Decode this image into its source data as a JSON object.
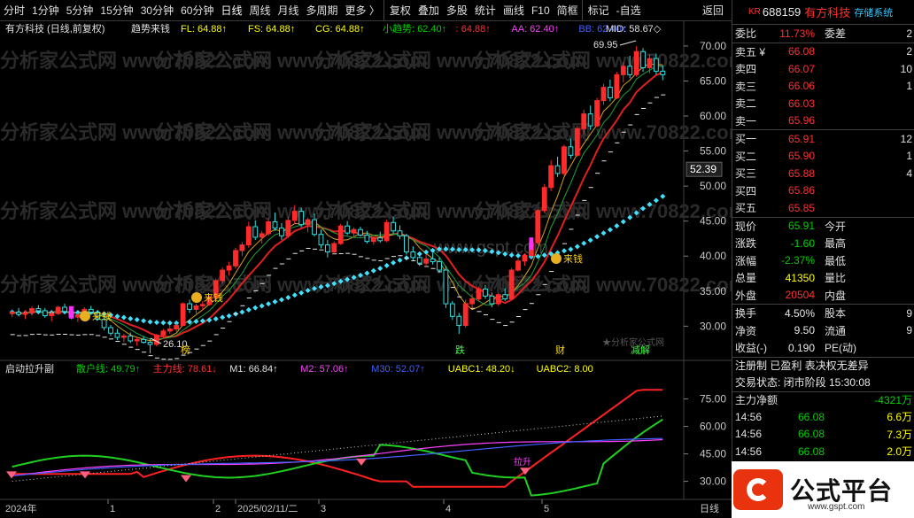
{
  "toolbar": {
    "items": [
      "分时",
      "1分钟",
      "5分钟",
      "15分钟",
      "30分钟",
      "60分钟",
      "日线",
      "周线",
      "月线",
      "多周期",
      "更多 〉",
      "复权",
      "叠加",
      "多股",
      "统计",
      "画线",
      "F10",
      "简框",
      "标记",
      "-自选",
      "返回"
    ]
  },
  "chart": {
    "title": "有方科技 (日线,前复权)",
    "indicator_name": "趋势来钱",
    "legend": [
      {
        "text": "FL: 64.88↑",
        "color": "#ffff00"
      },
      {
        "text": "FS: 64.88↑",
        "color": "#ffff00"
      },
      {
        "text": "CG: 64.88↑",
        "color": "#ffff00"
      },
      {
        "text": "小趋势: 62.40↑",
        "color": "#00d000"
      },
      {
        "text": ": 64.88↑",
        "color": "#ff3030"
      },
      {
        "text": "AA: 62.40↑",
        "color": "#ff40ff"
      },
      {
        "text": "BB: 62.40↑",
        "color": "#4060ff"
      },
      {
        "text": "MID: 58.67◇",
        "color": "#e0e0e0"
      }
    ],
    "yaxis": [
      "70.00",
      "65.00",
      "60.00",
      "55.00",
      "50.00",
      "45.00",
      "40.00",
      "35.00",
      "30.00"
    ],
    "price_marker": "52.39",
    "high_label": "69.95",
    "low_label": "26.10",
    "signals": [
      "来钱",
      "来钱",
      "来钱"
    ],
    "events": [
      "榜",
      "跌",
      "财",
      "减解"
    ],
    "watermark": "分析家公式网 www.70822.com",
    "watermark2": "www.gspt.com",
    "watermark3": "★分析家公式网",
    "chart_data": {
      "type": "candlestick",
      "ohlc": [
        [
          31.8,
          32.4,
          31.3,
          32.0
        ],
        [
          32.0,
          32.6,
          31.4,
          31.7
        ],
        [
          31.7,
          32.3,
          31.0,
          31.9
        ],
        [
          31.9,
          32.8,
          31.5,
          32.5
        ],
        [
          32.5,
          33.0,
          31.9,
          32.2
        ],
        [
          32.2,
          32.6,
          31.2,
          31.5
        ],
        [
          31.5,
          32.1,
          30.7,
          31.8
        ],
        [
          31.8,
          32.9,
          31.6,
          32.7
        ],
        [
          32.7,
          33.2,
          31.9,
          32.1
        ],
        [
          32.1,
          32.5,
          31.0,
          31.3
        ],
        [
          31.3,
          31.9,
          30.6,
          31.6
        ],
        [
          31.6,
          32.7,
          31.4,
          32.4
        ],
        [
          32.4,
          32.9,
          31.8,
          32.0
        ],
        [
          32.0,
          32.3,
          30.8,
          31.0
        ],
        [
          31.0,
          31.2,
          29.4,
          29.8
        ],
        [
          29.8,
          30.2,
          28.6,
          29.0
        ],
        [
          29.0,
          29.6,
          28.0,
          28.4
        ],
        [
          28.4,
          28.9,
          27.7,
          28.6
        ],
        [
          28.6,
          29.1,
          27.6,
          27.9
        ],
        [
          27.9,
          28.4,
          27.2,
          28.1
        ],
        [
          28.1,
          28.6,
          27.5,
          27.7
        ],
        [
          27.7,
          28.2,
          26.1,
          27.4
        ],
        [
          27.4,
          28.9,
          27.1,
          28.7
        ],
        [
          28.7,
          29.6,
          28.2,
          29.3
        ],
        [
          29.3,
          30.1,
          28.9,
          29.6
        ],
        [
          29.6,
          30.4,
          29.2,
          30.1
        ],
        [
          30.1,
          33.4,
          30.0,
          33.2
        ],
        [
          33.2,
          33.8,
          31.9,
          32.4
        ],
        [
          32.4,
          33.2,
          31.8,
          32.9
        ],
        [
          32.9,
          33.6,
          32.3,
          33.1
        ],
        [
          33.1,
          34.4,
          32.9,
          34.1
        ],
        [
          34.1,
          36.8,
          33.8,
          36.5
        ],
        [
          36.5,
          38.4,
          36.1,
          38.0
        ],
        [
          38.0,
          39.2,
          37.2,
          38.6
        ],
        [
          38.6,
          41.2,
          38.2,
          40.8
        ],
        [
          40.8,
          42.0,
          40.0,
          41.6
        ],
        [
          41.6,
          44.9,
          41.2,
          44.2
        ],
        [
          44.2,
          45.1,
          42.3,
          42.7
        ],
        [
          42.7,
          43.6,
          41.8,
          43.2
        ],
        [
          43.2,
          45.4,
          42.9,
          44.9
        ],
        [
          44.9,
          46.2,
          43.6,
          44.0
        ],
        [
          44.0,
          44.7,
          42.3,
          42.9
        ],
        [
          42.9,
          45.6,
          42.6,
          45.1
        ],
        [
          45.1,
          47.3,
          44.6,
          46.4
        ],
        [
          46.4,
          46.9,
          44.1,
          44.5
        ],
        [
          44.5,
          45.5,
          43.4,
          45.2
        ],
        [
          45.2,
          46.1,
          42.8,
          43.1
        ],
        [
          43.1,
          43.8,
          41.1,
          41.6
        ],
        [
          41.6,
          42.3,
          39.8,
          40.6
        ],
        [
          40.6,
          42.1,
          40.3,
          41.8
        ],
        [
          41.8,
          44.6,
          41.6,
          44.3
        ],
        [
          44.3,
          45.0,
          43.0,
          43.3
        ],
        [
          43.3,
          44.1,
          42.6,
          43.8
        ],
        [
          43.8,
          44.2,
          42.8,
          43.0
        ],
        [
          43.0,
          43.6,
          41.8,
          42.1
        ],
        [
          42.1,
          42.8,
          41.6,
          42.6
        ],
        [
          42.6,
          43.5,
          41.9,
          42.2
        ],
        [
          42.2,
          45.2,
          42.0,
          44.8
        ],
        [
          44.8,
          45.6,
          43.2,
          43.6
        ],
        [
          43.6,
          44.4,
          42.4,
          42.9
        ],
        [
          42.9,
          43.2,
          40.2,
          40.6
        ],
        [
          40.6,
          41.4,
          39.4,
          39.8
        ],
        [
          39.8,
          40.6,
          38.6,
          39.0
        ],
        [
          39.0,
          40.2,
          38.4,
          39.6
        ],
        [
          39.6,
          40.4,
          38.8,
          39.2
        ],
        [
          39.2,
          39.8,
          37.6,
          38.0
        ],
        [
          38.0,
          38.6,
          32.6,
          33.2
        ],
        [
          33.2,
          33.6,
          30.9,
          31.4
        ],
        [
          31.4,
          31.9,
          28.9,
          30.1
        ],
        [
          30.1,
          33.8,
          29.8,
          33.2
        ],
        [
          33.2,
          34.6,
          32.6,
          33.9
        ],
        [
          33.9,
          35.6,
          33.6,
          35.3
        ],
        [
          35.3,
          35.9,
          33.9,
          34.3
        ],
        [
          34.3,
          34.8,
          32.7,
          33.2
        ],
        [
          33.2,
          34.7,
          32.9,
          34.5
        ],
        [
          34.5,
          35.4,
          33.6,
          33.9
        ],
        [
          33.9,
          38.3,
          33.8,
          38.0
        ],
        [
          38.0,
          39.6,
          37.8,
          39.3
        ],
        [
          39.3,
          40.4,
          38.6,
          40.1
        ],
        [
          40.1,
          42.3,
          39.8,
          41.9
        ],
        [
          41.9,
          46.7,
          41.7,
          46.5
        ],
        [
          46.5,
          50.3,
          46.2,
          49.8
        ],
        [
          49.8,
          53.7,
          49.3,
          52.9
        ],
        [
          52.9,
          54.2,
          51.3,
          51.8
        ],
        [
          51.8,
          55.9,
          51.5,
          55.6
        ],
        [
          55.6,
          56.8,
          53.9,
          54.4
        ],
        [
          54.4,
          58.6,
          54.2,
          58.2
        ],
        [
          58.2,
          60.9,
          57.4,
          60.3
        ],
        [
          60.3,
          61.5,
          58.0,
          58.6
        ],
        [
          58.6,
          62.6,
          58.4,
          62.2
        ],
        [
          62.2,
          64.6,
          61.6,
          64.1
        ],
        [
          64.1,
          65.2,
          62.1,
          62.6
        ],
        [
          62.6,
          66.3,
          62.4,
          65.9
        ],
        [
          65.9,
          67.7,
          64.8,
          67.1
        ],
        [
          67.1,
          68.6,
          65.4,
          65.9
        ],
        [
          65.9,
          69.95,
          65.6,
          69.2
        ],
        [
          69.2,
          69.7,
          66.3,
          66.9
        ],
        [
          66.9,
          68.8,
          66.1,
          68.2
        ],
        [
          68.2,
          68.9,
          65.9,
          66.4
        ],
        [
          66.4,
          67.2,
          65.1,
          65.9
        ]
      ],
      "x": [
        "2024年",
        "1",
        "2",
        "2025/02/11/二",
        "3",
        "4",
        "5",
        "线"
      ],
      "ylim": [
        26,
        71
      ]
    }
  },
  "sub": {
    "title": "启动拉升副",
    "legend": [
      {
        "text": "散户线: 49.79↑",
        "color": "#00d000"
      },
      {
        "text": "主力线: 78.61↓",
        "color": "#ff3030"
      },
      {
        "text": "M1: 66.84↑",
        "color": "#e0e0e0"
      },
      {
        "text": "M2: 57.06↑",
        "color": "#ff40ff"
      },
      {
        "text": "M30: 52.07↑",
        "color": "#4060ff"
      },
      {
        "text": "UABC1: 48.20↓",
        "color": "#ffff00"
      },
      {
        "text": "UABC2: 8.00",
        "color": "#ffff00"
      }
    ],
    "yaxis": [
      "75.00",
      "60.00",
      "45.00",
      "30.00"
    ],
    "marker": "拉升"
  },
  "xaxis": [
    "2024年",
    "1",
    "2",
    "2025/02/11/二",
    "3",
    "4",
    "5",
    "日线"
  ],
  "panel": {
    "code": "688159",
    "name": "有方科技",
    "tag": "存储系统",
    "kr": "KR",
    "weibi_label": "委比",
    "weibi": "11.73%",
    "weicha_label": "委差",
    "weicha": "2",
    "asks": [
      {
        "l": "卖五 ¥",
        "p": "66.08",
        "v": "2"
      },
      {
        "l": "卖四",
        "p": "66.07",
        "v": "10"
      },
      {
        "l": "卖三",
        "p": "66.06",
        "v": "1"
      },
      {
        "l": "卖二",
        "p": "66.03",
        "v": ""
      },
      {
        "l": "卖一",
        "p": "65.96",
        "v": ""
      }
    ],
    "bids": [
      {
        "l": "买一",
        "p": "65.91",
        "v": "12"
      },
      {
        "l": "买二",
        "p": "65.90",
        "v": "1"
      },
      {
        "l": "买三",
        "p": "65.88",
        "v": "4"
      },
      {
        "l": "买四",
        "p": "65.86",
        "v": ""
      },
      {
        "l": "买五",
        "p": "65.85",
        "v": ""
      }
    ],
    "quote": [
      {
        "l": "现价",
        "v": "65.91",
        "c": "grn",
        "l2": "今开"
      },
      {
        "l": "涨跌",
        "v": "-1.60",
        "c": "grn",
        "l2": "最高"
      },
      {
        "l": "涨幅",
        "v": "-2.37%",
        "c": "grn",
        "l2": "最低"
      },
      {
        "l": "总量",
        "v": "41350",
        "c": "yel",
        "l2": "量比"
      },
      {
        "l": "外盘",
        "v": "20504",
        "c": "red",
        "l2": "内盘"
      }
    ],
    "stats": [
      {
        "l": "换手",
        "v": "4.50%",
        "l2": "股本",
        "v2": "9"
      },
      {
        "l": "净资",
        "v": "9.50",
        "l2": "流通",
        "v2": "9"
      },
      {
        "l": "收益(-)",
        "v": "0.190",
        "l2": "PE(动)",
        "v2": ""
      }
    ],
    "notes": "注册制 已盈利 表决权无差异",
    "state": "交易状态: 闭市阶段 15:30:08",
    "flow_label": "主力净额",
    "flow": "-4321万",
    "trades": [
      {
        "t": "14:56",
        "p": "66.08",
        "v": "6.6万"
      },
      {
        "t": "14:56",
        "p": "66.08",
        "v": "7.3万"
      },
      {
        "t": "14:56",
        "p": "66.08",
        "v": "2.0万"
      }
    ]
  },
  "logo": {
    "text": "公式平台",
    "url": "www.gspt.com"
  }
}
